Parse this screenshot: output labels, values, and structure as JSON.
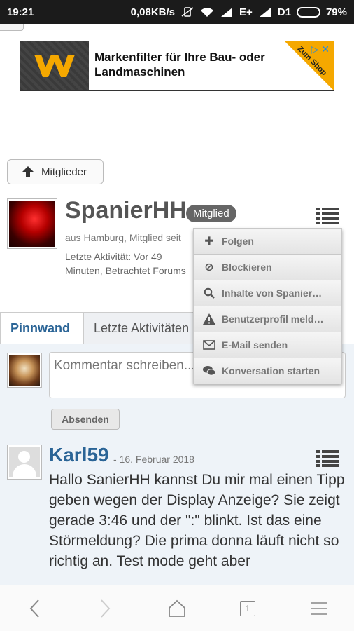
{
  "status_bar": {
    "time": "19:21",
    "speed": "0,08KB/s",
    "network1": "E+",
    "network2": "D1",
    "battery": "79%",
    "battery_level": 0.79
  },
  "ad": {
    "text": "Markenfilter für Ihre Bau- oder Landmaschinen",
    "corner_label": "Zum Shop"
  },
  "back_button": {
    "label": "Mitglieder"
  },
  "profile": {
    "username": "SpanierHH",
    "badge": "Mitglied",
    "location_line": "aus Hamburg, Mitglied seit",
    "activity_line": "Letzte Aktivität: Vor 49 Minuten, Betrachtet Forums"
  },
  "menu": {
    "items": [
      {
        "label": "Folgen",
        "icon": "plus-icon"
      },
      {
        "label": "Blockieren",
        "icon": "ban-icon"
      },
      {
        "label": "Inhalte von Spanier…",
        "icon": "search-icon"
      },
      {
        "label": "Benutzerprofil meld…",
        "icon": "warning-icon"
      },
      {
        "label": "E-Mail senden",
        "icon": "envelope-icon"
      },
      {
        "label": "Konversation starten",
        "icon": "chat-icon"
      }
    ]
  },
  "tabs": [
    {
      "label": "Pinnwand",
      "active": true
    },
    {
      "label": "Letzte Aktivitäten",
      "active": false
    }
  ],
  "comment": {
    "placeholder": "Kommentar schreiben...",
    "submit_label": "Absenden"
  },
  "post": {
    "author": "Karl59",
    "date": "- 16. Februar 2018",
    "text": "Hallo SanierHH kannst Du mir mal einen Tipp geben wegen der Display Anzeige? Sie zeigt gerade 3:46 und der \":\" blinkt. Ist das eine Störmeldung? Die prima donna läuft nicht so richtig an. Test mode geht aber"
  },
  "browser_nav": {
    "tab_count": "1"
  }
}
